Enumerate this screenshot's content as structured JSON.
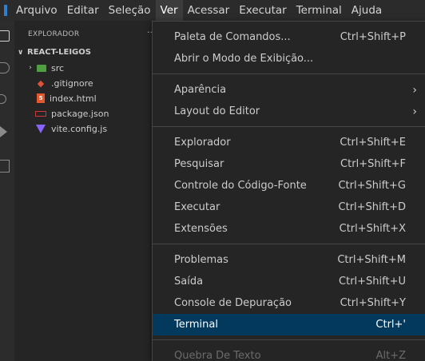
{
  "menubar": {
    "items": [
      {
        "label": "Arquivo"
      },
      {
        "label": "Editar"
      },
      {
        "label": "Seleção"
      },
      {
        "label": "Ver"
      },
      {
        "label": "Acessar"
      },
      {
        "label": "Executar"
      },
      {
        "label": "Terminal"
      },
      {
        "label": "Ajuda"
      }
    ],
    "active": "Ver"
  },
  "sidebar": {
    "header": "EXPLORADOR",
    "more": "···",
    "folder": "REACT-LEIGOS",
    "items": [
      {
        "label": "src",
        "icon": "folder-icon"
      },
      {
        "label": ".gitignore",
        "icon": "git-icon"
      },
      {
        "label": "index.html",
        "icon": "html-icon"
      },
      {
        "label": "package.json",
        "icon": "npm-icon"
      },
      {
        "label": "vite.config.js",
        "icon": "vite-icon"
      }
    ]
  },
  "view_menu": {
    "groups": [
      [
        {
          "label": "Paleta de Comandos...",
          "shortcut": "Ctrl+Shift+P"
        },
        {
          "label": "Abrir o Modo de Exibição...",
          "shortcut": ""
        }
      ],
      [
        {
          "label": "Aparência",
          "shortcut": "",
          "submenu": true
        },
        {
          "label": "Layout do Editor",
          "shortcut": "",
          "submenu": true
        }
      ],
      [
        {
          "label": "Explorador",
          "shortcut": "Ctrl+Shift+E"
        },
        {
          "label": "Pesquisar",
          "shortcut": "Ctrl+Shift+F"
        },
        {
          "label": "Controle do Código-Fonte",
          "shortcut": "Ctrl+Shift+G"
        },
        {
          "label": "Executar",
          "shortcut": "Ctrl+Shift+D"
        },
        {
          "label": "Extensões",
          "shortcut": "Ctrl+Shift+X"
        }
      ],
      [
        {
          "label": "Problemas",
          "shortcut": "Ctrl+Shift+M"
        },
        {
          "label": "Saída",
          "shortcut": "Ctrl+Shift+U"
        },
        {
          "label": "Console de Depuração",
          "shortcut": "Ctrl+Shift+Y"
        },
        {
          "label": "Terminal",
          "shortcut": "Ctrl+'",
          "selected": true
        }
      ],
      [
        {
          "label": "Quebra De Texto",
          "shortcut": "Alt+Z",
          "disabled": true
        }
      ]
    ],
    "submenu_arrow": "›"
  },
  "colors": {
    "selection": "#04395e",
    "menu_bg": "#252526",
    "sidebar_bg": "#252526",
    "titlebar_bg": "#2b2b2b"
  }
}
